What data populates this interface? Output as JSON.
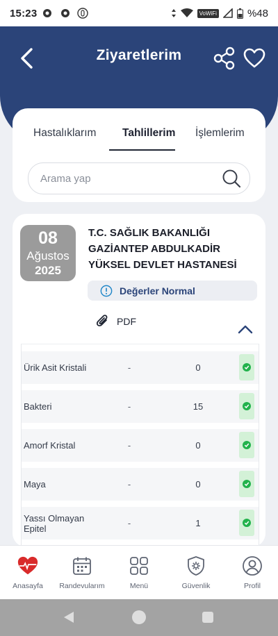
{
  "status_bar": {
    "time": "15:23",
    "network_label": "VoWiFi",
    "battery": "%48"
  },
  "header": {
    "title": "Ziyaretlerim",
    "background_color": "#2b4479"
  },
  "tabs": [
    {
      "label": "Hastalıklarım",
      "active": false
    },
    {
      "label": "Tahlillerim",
      "active": true
    },
    {
      "label": "İşlemlerim",
      "active": false
    }
  ],
  "search": {
    "placeholder": "Arama yap",
    "value": ""
  },
  "visit": {
    "day": "08",
    "month": "Ağustos",
    "year": "2025",
    "hospital": "T.C. SAĞLIK BAKANLIĞI GAZİANTEP ABDULKADİR YÜKSEL DEVLET HASTANESİ",
    "status": "Değerler Normal",
    "pdf_label": "PDF",
    "results": [
      {
        "name": "Ürik Asit Kristali",
        "reference": "-",
        "value": "0",
        "normal": true
      },
      {
        "name": "Bakteri",
        "reference": "-",
        "value": "15",
        "normal": true
      },
      {
        "name": "Amorf Kristal",
        "reference": "-",
        "value": "0",
        "normal": true
      },
      {
        "name": "Maya",
        "reference": "-",
        "value": "0",
        "normal": true
      },
      {
        "name": "Yassı Olmayan Epitel",
        "reference": "-",
        "value": "1",
        "normal": true
      }
    ]
  },
  "bottom_nav": [
    {
      "label": "Anasayfa",
      "icon": "heart-home-icon"
    },
    {
      "label": "Randevularım",
      "icon": "calendar-icon"
    },
    {
      "label": "Menü",
      "icon": "grid-icon"
    },
    {
      "label": "Güvenlik",
      "icon": "shield-gear-icon"
    },
    {
      "label": "Profil",
      "icon": "profile-icon"
    }
  ],
  "colors": {
    "accent": "#2b4479",
    "normal_green": "#22b24c",
    "date_badge": "#9b9b9b"
  }
}
